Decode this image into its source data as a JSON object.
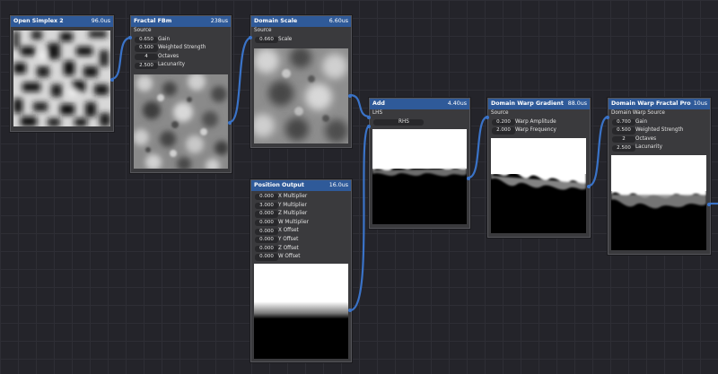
{
  "colors": {
    "header": "#2f5a99",
    "wire": "#3a73c8",
    "canvas": "#24242a",
    "node_body": "#3a3a3d"
  },
  "nodes": {
    "open_simplex": {
      "title": "Open Simplex 2",
      "time": "96.0us"
    },
    "fractal_fbm": {
      "title": "Fractal FBm",
      "time": "238us",
      "input": "Source",
      "gain": {
        "value": "0.650",
        "label": "Gain"
      },
      "weighted_strength": {
        "value": "0.500",
        "label": "Weighted Strength"
      },
      "octaves": {
        "value": "4",
        "label": "Octaves"
      },
      "lacunarity": {
        "value": "2.500",
        "label": "Lacunarity"
      }
    },
    "domain_scale": {
      "title": "Domain Scale",
      "time": "6.60us",
      "input": "Source",
      "scale": {
        "value": "0.660",
        "label": "Scale"
      }
    },
    "add": {
      "title": "Add",
      "time": "4.40us",
      "lhs": "LHS",
      "rhs": "RHS"
    },
    "position_output": {
      "title": "Position Output",
      "time": "16.0us",
      "x_multiplier": {
        "value": "0.000",
        "label": "X Multiplier"
      },
      "y_multiplier": {
        "value": "3.000",
        "label": "Y Multiplier"
      },
      "z_multiplier": {
        "value": "0.000",
        "label": "Z Multiplier"
      },
      "w_multiplier": {
        "value": "0.000",
        "label": "W Multiplier"
      },
      "x_offset": {
        "value": "0.000",
        "label": "X Offset"
      },
      "y_offset": {
        "value": "0.000",
        "label": "Y Offset"
      },
      "z_offset": {
        "value": "0.000",
        "label": "Z Offset"
      },
      "w_offset": {
        "value": "0.000",
        "label": "W Offset"
      }
    },
    "domain_warp_gradient": {
      "title": "Domain Warp Gradient",
      "time": "88.0us",
      "input": "Source",
      "warp_amplitude": {
        "value": "0.200",
        "label": "Warp Amplitude"
      },
      "warp_frequency": {
        "value": "2.000",
        "label": "Warp Frequency"
      }
    },
    "domain_warp_fractal": {
      "title": "Domain Warp Fractal Progressive",
      "time": "10us",
      "input": "Domain Warp Source",
      "gain": {
        "value": "0.700",
        "label": "Gain"
      },
      "weighted_strength": {
        "value": "0.500",
        "label": "Weighted Strength"
      },
      "octaves": {
        "value": "2",
        "label": "Octaves"
      },
      "lacunarity": {
        "value": "2.500",
        "label": "Lacunarity"
      }
    }
  }
}
